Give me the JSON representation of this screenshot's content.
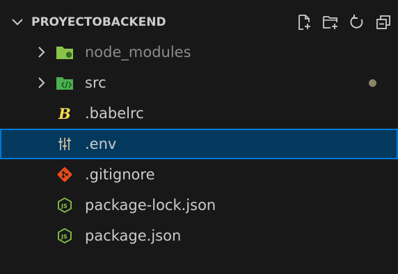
{
  "explorer": {
    "title": "PROYECTOBACKEND",
    "actions": [
      {
        "name": "new-file",
        "icon": "new-file-icon"
      },
      {
        "name": "new-folder",
        "icon": "new-folder-icon"
      },
      {
        "name": "refresh",
        "icon": "refresh-icon"
      },
      {
        "name": "collapse-all",
        "icon": "collapse-all-icon"
      }
    ]
  },
  "tree": {
    "items": [
      {
        "label": "node_modules",
        "type": "folder",
        "icon": "node-folder-icon",
        "dimmed": true
      },
      {
        "label": "src",
        "type": "folder",
        "icon": "src-folder-icon",
        "modified": true
      },
      {
        "label": ".babelrc",
        "type": "file",
        "icon": "babel-icon"
      },
      {
        "label": ".env",
        "type": "file",
        "icon": "env-settings-icon",
        "selected": true
      },
      {
        "label": ".gitignore",
        "type": "file",
        "icon": "git-icon"
      },
      {
        "label": "package-lock.json",
        "type": "file",
        "icon": "nodejs-icon"
      },
      {
        "label": "package.json",
        "type": "file",
        "icon": "nodejs-icon"
      }
    ]
  },
  "colors": {
    "background": "#181818",
    "selection_bg": "#04395e",
    "selection_border": "#0078d4",
    "node_folder": "#8bc34a",
    "src_folder": "#4caf50",
    "babel": "#f5da55",
    "git": "#e64a19",
    "nodejs": "#8bc34a",
    "modified_dot": "#8a8568"
  }
}
